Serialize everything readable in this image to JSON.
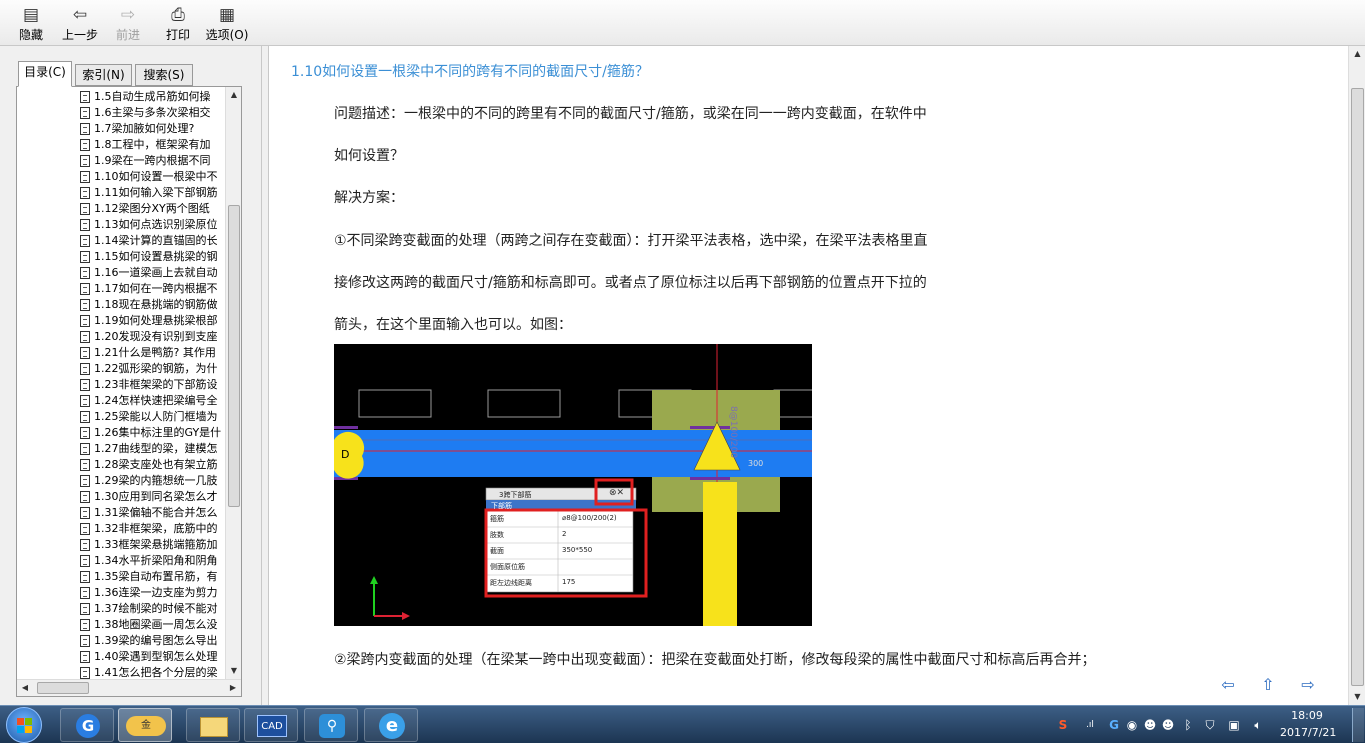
{
  "toolbar": {
    "hide": "隐藏",
    "back": "上一步",
    "forward": "前进",
    "print": "打印",
    "options": "选项(O)"
  },
  "tabs": {
    "contents": "目录(C)",
    "index": "索引(N)",
    "search": "搜索(S)"
  },
  "tree": [
    "1.5自动生成吊筋如何操",
    "1.6主梁与多条次梁相交",
    "1.7梁加腋如何处理?",
    "1.8工程中，框架梁有加",
    "1.9梁在一跨内根据不同",
    "1.10如何设置一根梁中不",
    "1.11如何输入梁下部钢筋",
    "1.12梁图分XY两个图纸",
    "1.13如何点选识别梁原位",
    "1.14梁计算的直锚固的长",
    "1.15如何设置悬挑梁的钢",
    "1.16一道梁画上去就自动",
    "1.17如何在一跨内根据不",
    "1.18现在悬挑端的钢筋做",
    "1.19如何处理悬挑梁根部",
    "1.20发现没有识别到支座",
    "1.21什么是鸭筋? 其作用",
    "1.22弧形梁的钢筋，为什",
    "1.23非框架梁的下部筋设",
    "1.24怎样快速把梁编号全",
    "1.25梁能以人防门框墙为",
    "1.26集中标注里的GY是什",
    "1.27曲线型的梁，建模怎",
    "1.28梁支座处也有架立筋",
    "1.29梁的内箍想统一几肢",
    "1.30应用到同名梁怎么才",
    "1.31梁偏轴不能合并怎么",
    "1.32非框架梁，底筋中的",
    "1.33框架梁悬挑端箍筋加",
    "1.34水平折梁阳角和阴角",
    "1.35梁自动布置吊筋，有",
    "1.36连梁一边支座为剪力",
    "1.37绘制梁的时候不能对",
    "1.38地圈梁画一周怎么没",
    "1.39梁的编号图怎么导出",
    "1.40梁遇到型钢怎么处理",
    "1.41怎么把各个分层的梁"
  ],
  "article": {
    "title": "1.10如何设置一根梁中不同的跨有不同的截面尺寸/箍筋？",
    "p1": "问题描述：一根梁中的不同的跨里有不同的截面尺寸/箍筋，或梁在同一一跨内变截面，在软件中",
    "p2": "如何设置？",
    "p3": "解决方案：",
    "p4": "①不同梁跨变截面的处理（两跨之间存在变截面）：打开梁平法表格，选中梁，在梁平法表格里直",
    "p5": "接修改这两跨的截面尺寸/箍筋和标高即可。或者点了原位标注以后再下部钢筋的位置点开下拉的",
    "p6": "箭头，在这个里面输入也可以。如图：",
    "p7": "②梁跨内变截面的处理（在梁某一跨中出现变截面）：把梁在变截面处打断，修改每段梁的属性中截面尺寸和标高后再合并；"
  },
  "cad": {
    "header_row": "3跨下部筋",
    "header_sub": "下部筋",
    "rows": [
      [
        "箍筋",
        "⌀8@100/200(2)"
      ],
      [
        "肢数",
        "2"
      ],
      [
        "截面",
        "350*550"
      ],
      [
        "侧面原位筋",
        ""
      ],
      [
        "距左边线距离",
        "175"
      ]
    ],
    "side_label": "8@100/200",
    "side_label2": "300",
    "left_marker": "D"
  },
  "taskbar": {
    "time": "18:09",
    "date": "2017/7/21",
    "apps": [
      "G",
      "金",
      "文件夹",
      "CAD",
      "工具",
      "e"
    ]
  }
}
